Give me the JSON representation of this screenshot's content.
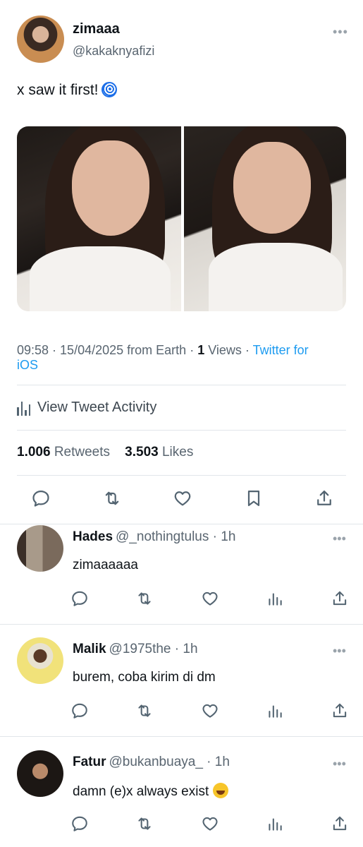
{
  "tweet": {
    "display_name": "zimaaa",
    "handle": "@kakaknyafizi",
    "text": "x saw it first!",
    "time": "09:58",
    "date": "15/04/2025",
    "location": "from Earth",
    "views_count": "1",
    "views_label": "Views",
    "client_line1": "Twitter for",
    "client_line2": "iOS",
    "activity_label": "View Tweet Activity",
    "retweets_count": "1.006",
    "retweets_label": "Retweets",
    "likes_count": "3.503",
    "likes_label": "Likes",
    "emoji_icon": "cyclone-icon"
  },
  "colors": {
    "link": "#1d9bf0",
    "muted": "#596570",
    "text": "#0f1419",
    "divider": "#e1e6ea"
  },
  "replies": [
    {
      "name": "Hades",
      "handle": "@_nothingtulus",
      "time": "1h",
      "text": "zimaaaaaa"
    },
    {
      "name": "Malik",
      "handle": "@1975the",
      "time": "1h",
      "text": "burem, coba kirim di dm"
    },
    {
      "name": "Fatur",
      "handle": "@bukanbuaya_",
      "time": "1h",
      "text": "damn (e)x always exist",
      "emoji": "laughing-tears-icon"
    }
  ]
}
